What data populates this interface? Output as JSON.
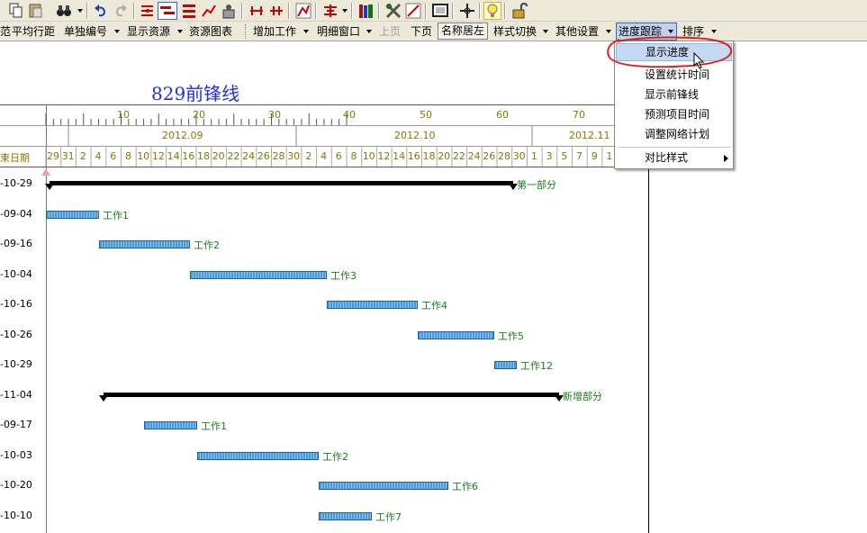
{
  "toolbar2": {
    "items": [
      {
        "label": "平均行距",
        "dd": false
      },
      {
        "label": "单独编号",
        "dd": true
      },
      {
        "label": "显示资源",
        "dd": true
      },
      {
        "label": "资源图表",
        "dd": false
      },
      {
        "label": "增加工作",
        "dd": true
      },
      {
        "label": "明细窗口",
        "dd": true
      },
      {
        "label": "上页",
        "dd": false,
        "disabled": true
      },
      {
        "label": "下页",
        "dd": false
      },
      {
        "label": "名称居左",
        "dd": false,
        "pressed": true
      },
      {
        "label": "样式切换",
        "dd": true
      },
      {
        "label": "其他设置",
        "dd": true
      },
      {
        "label": "进度跟踪",
        "dd": true,
        "active": true
      },
      {
        "label": "排序",
        "dd": true
      }
    ]
  },
  "chart": {
    "title": "829前锋线",
    "ruler_numbers": [
      "10",
      "20",
      "30",
      "40",
      "50",
      "60",
      "70"
    ],
    "months": [
      "2012.09",
      "2012.10",
      "2012.11"
    ],
    "days": [
      "29",
      "31",
      "2",
      "4",
      "6",
      "8",
      "10",
      "12",
      "14",
      "16",
      "18",
      "20",
      "22",
      "24",
      "26",
      "28",
      "30",
      "2",
      "4",
      "6",
      "8",
      "10",
      "12",
      "14",
      "16",
      "18",
      "20",
      "22",
      "24",
      "26",
      "28",
      "30",
      "1",
      "3",
      "5",
      "7",
      "9",
      "1"
    ],
    "date_col_header": "束日期",
    "rows": [
      {
        "date": "-10-29",
        "label": "第一部分",
        "summary": true
      },
      {
        "date": "-09-04",
        "label": "工作1"
      },
      {
        "date": "-09-16",
        "label": "工作2"
      },
      {
        "date": "-10-04",
        "label": "工作3"
      },
      {
        "date": "-10-16",
        "label": "工作4"
      },
      {
        "date": "-10-26",
        "label": "工作5"
      },
      {
        "date": "-10-29",
        "label": "工作12"
      },
      {
        "date": "-11-04",
        "label": "新增部分",
        "summary": true
      },
      {
        "date": "-09-17",
        "label": "工作1"
      },
      {
        "date": "-10-03",
        "label": "工作2"
      },
      {
        "date": "-10-20",
        "label": "工作6"
      },
      {
        "date": "-10-10",
        "label": "工作7"
      }
    ]
  },
  "menu": {
    "items": [
      "显示进度",
      "设置统计时间",
      "显示前锋线",
      "预测项目时间",
      "调整网络计划",
      "对比样式"
    ],
    "highlighted": "显示进度"
  },
  "colors": {
    "title": "#1f2fe0",
    "bar_fill": "#4a9ae0",
    "label": "#1e7a1e",
    "annotation": "#e02020"
  }
}
